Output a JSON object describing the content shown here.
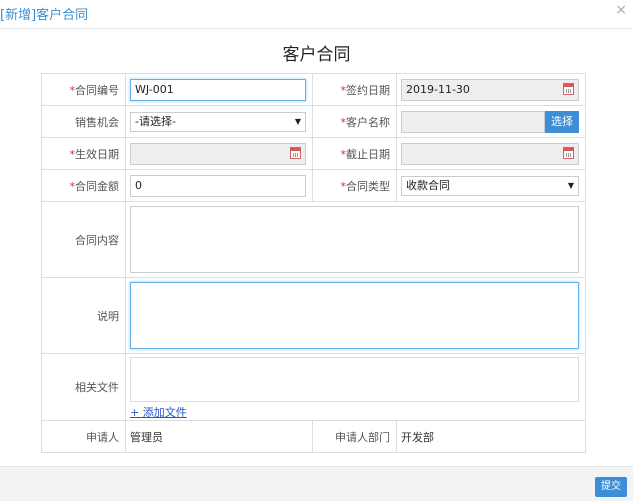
{
  "window": {
    "title": "[新增]客户合同",
    "close_icon": "×"
  },
  "form": {
    "heading": "客户合同",
    "contract_no": {
      "label": "合同编号",
      "value": "WJ-001"
    },
    "sign_date": {
      "label": "签约日期",
      "value": "2019-11-30"
    },
    "sales_opportunity": {
      "label": "销售机会",
      "value": "-请选择-"
    },
    "customer_name": {
      "label": "客户名称",
      "value": "",
      "button": "选择"
    },
    "effective_date": {
      "label": "生效日期",
      "value": ""
    },
    "end_date": {
      "label": "截止日期",
      "value": ""
    },
    "amount": {
      "label": "合同金额",
      "value": "0"
    },
    "contract_type": {
      "label": "合同类型",
      "value": "收款合同"
    },
    "content": {
      "label": "合同内容"
    },
    "remark": {
      "label": "说明"
    },
    "files": {
      "label": "相关文件",
      "add_link": "+ 添加文件"
    },
    "applicant": {
      "label": "申请人",
      "value": "管理员"
    },
    "department": {
      "label": "申请人部门",
      "value": "开发部"
    }
  },
  "footer": {
    "submit_label": "提交"
  },
  "colors": {
    "accent": "#3c8ed6",
    "required": "#e22233",
    "title": "#3a8fd6"
  }
}
